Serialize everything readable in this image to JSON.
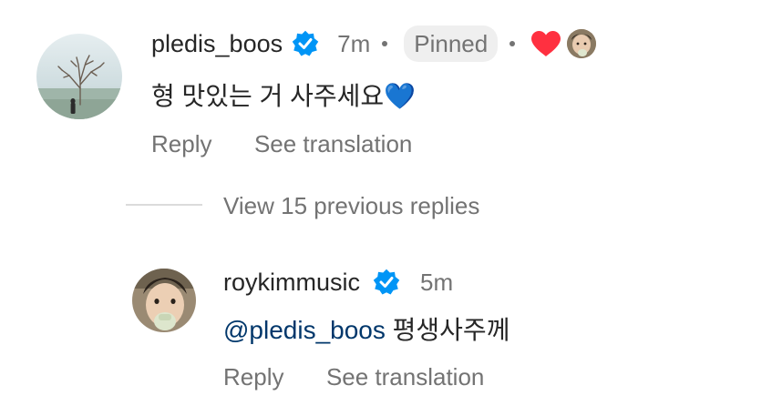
{
  "comment": {
    "username": "pledis_boos",
    "time": "7m",
    "pinned_label": "Pinned",
    "text": "형 맛있는 거 사주세요💙",
    "reply_label": "Reply",
    "translate_label": "See translation",
    "liked_by_author": true,
    "heart_color": "#ff3040"
  },
  "replies_toggle": {
    "label": "View 15 previous replies"
  },
  "reply": {
    "username": "roykimmusic",
    "time": "5m",
    "mention": "@pledis_boos",
    "text": "평생사주께",
    "reply_label": "Reply",
    "translate_label": "See translation"
  },
  "colors": {
    "verified_blue": "#0095f6",
    "mention_blue": "#00376b",
    "secondary_text": "#737373"
  }
}
